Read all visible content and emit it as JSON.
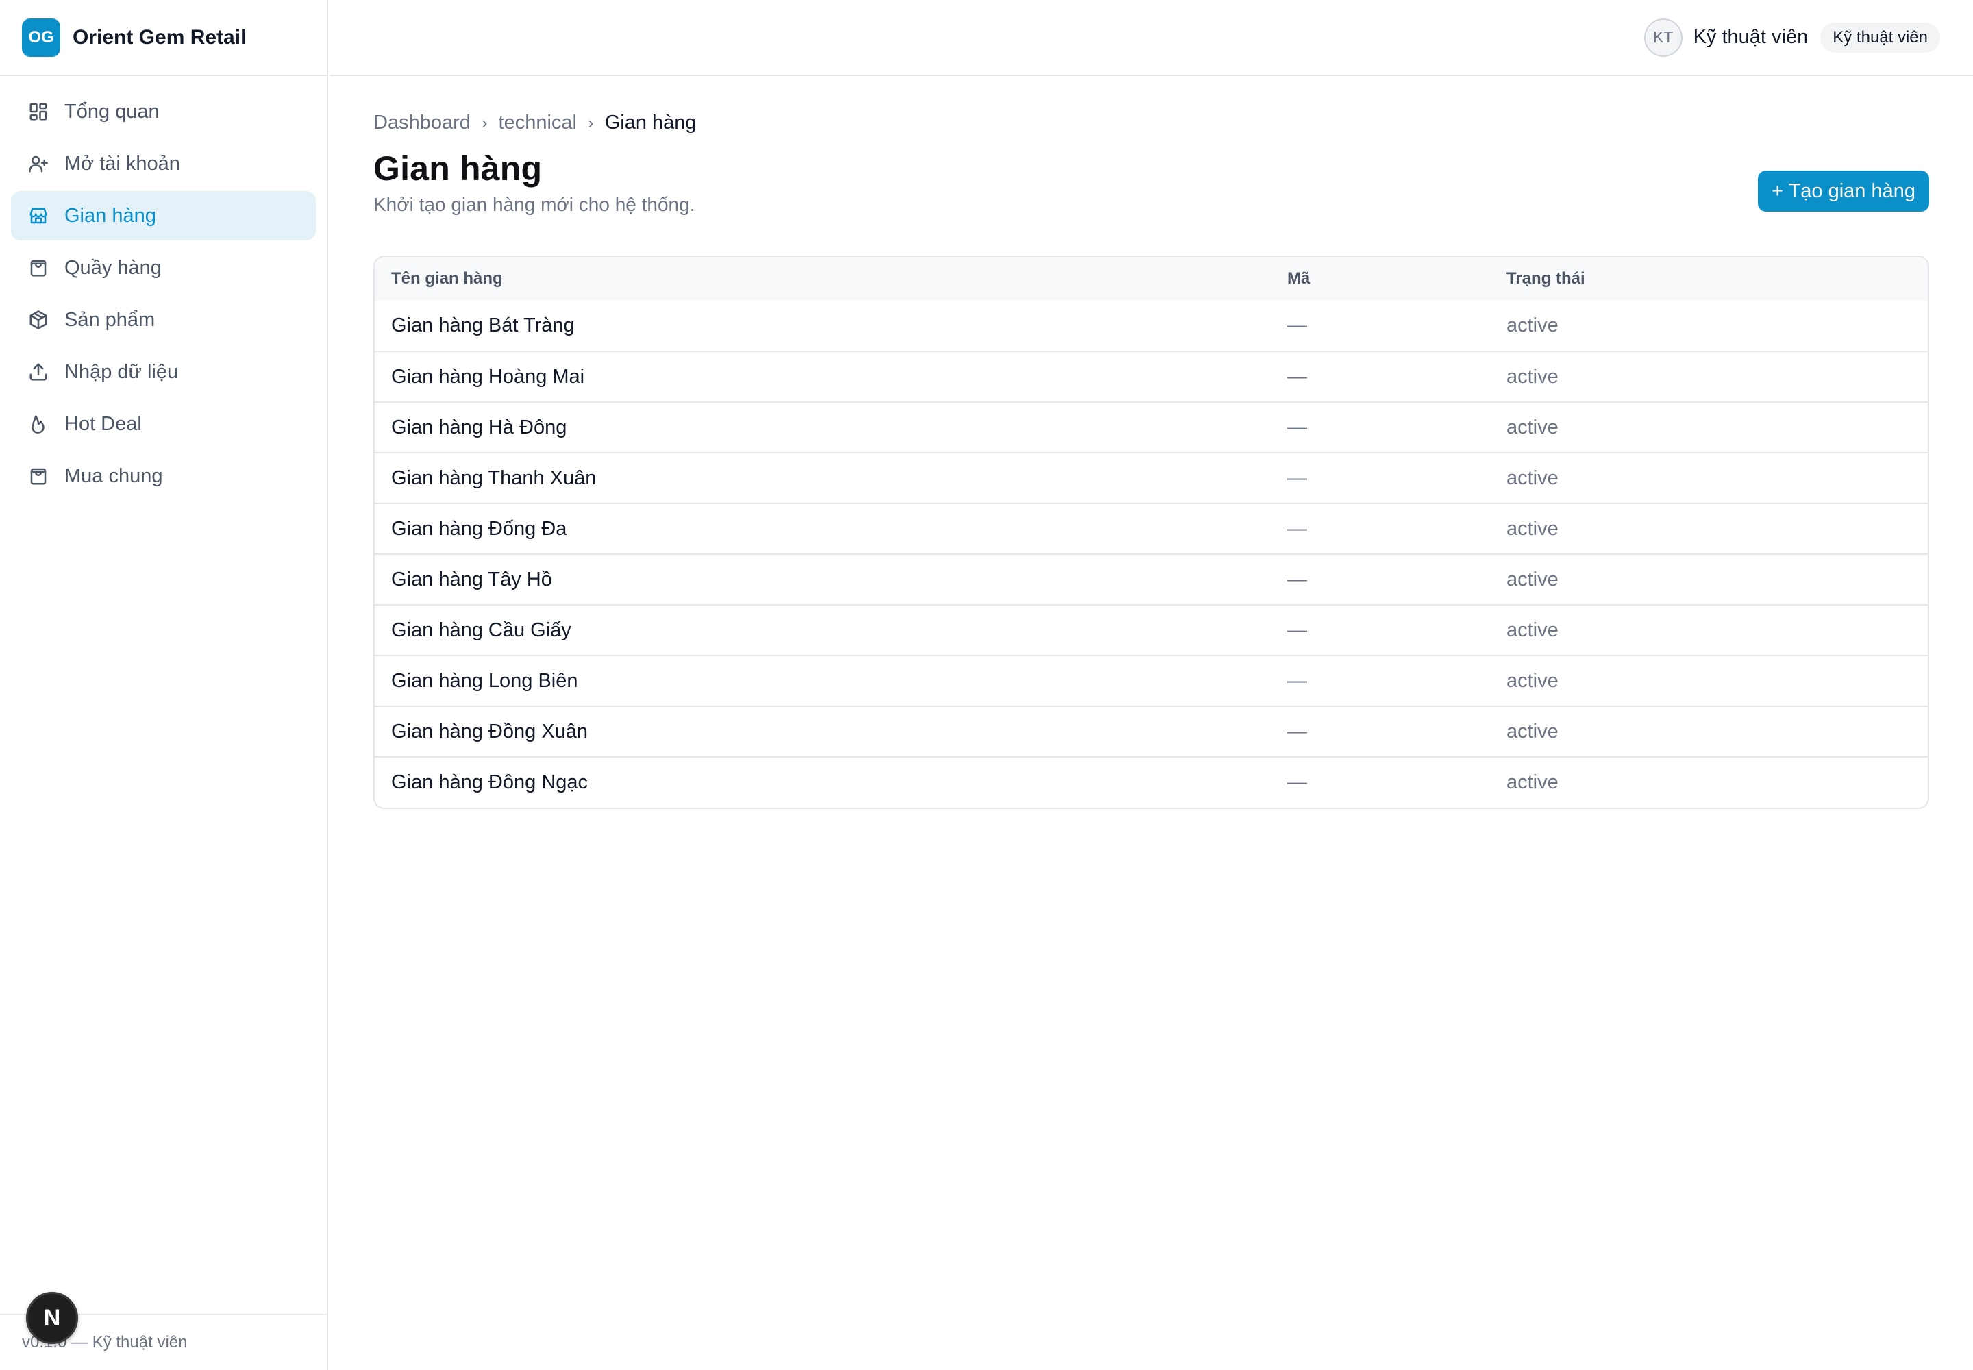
{
  "brand": {
    "logo": "OG",
    "name": "Orient Gem Retail"
  },
  "sidebar": {
    "items": [
      {
        "label": "Tổng quan",
        "icon": "dashboard-icon",
        "active": false
      },
      {
        "label": "Mở tài khoản",
        "icon": "user-plus-icon",
        "active": false
      },
      {
        "label": "Gian hàng",
        "icon": "store-icon",
        "active": true
      },
      {
        "label": "Quầy hàng",
        "icon": "shopping-bag-icon",
        "active": false
      },
      {
        "label": "Sản phẩm",
        "icon": "box-icon",
        "active": false
      },
      {
        "label": "Nhập dữ liệu",
        "icon": "upload-icon",
        "active": false
      },
      {
        "label": "Hot Deal",
        "icon": "flame-icon",
        "active": false
      },
      {
        "label": "Mua chung",
        "icon": "shopping-bag-icon",
        "active": false
      }
    ],
    "footer": "v0.1.0 — Kỹ thuật viên",
    "dev_badge": "N"
  },
  "header": {
    "avatar": "KT",
    "user_name": "Kỹ thuật viên",
    "role": "Kỹ thuật viên"
  },
  "breadcrumb": [
    "Dashboard",
    "technical",
    "Gian hàng"
  ],
  "page": {
    "title": "Gian hàng",
    "subtitle": "Khởi tạo gian hàng mới cho hệ thống.",
    "create_button": "+ Tạo gian hàng"
  },
  "table": {
    "columns": [
      "Tên gian hàng",
      "Mã",
      "Trạng thái"
    ],
    "rows": [
      {
        "name": "Gian hàng Bát Tràng",
        "code": "—",
        "status": "active"
      },
      {
        "name": "Gian hàng Hoàng Mai",
        "code": "—",
        "status": "active"
      },
      {
        "name": "Gian hàng Hà Đông",
        "code": "—",
        "status": "active"
      },
      {
        "name": "Gian hàng Thanh Xuân",
        "code": "—",
        "status": "active"
      },
      {
        "name": "Gian hàng Đống Đa",
        "code": "—",
        "status": "active"
      },
      {
        "name": "Gian hàng Tây Hồ",
        "code": "—",
        "status": "active"
      },
      {
        "name": "Gian hàng Cầu Giấy",
        "code": "—",
        "status": "active"
      },
      {
        "name": "Gian hàng Long Biên",
        "code": "—",
        "status": "active"
      },
      {
        "name": "Gian hàng Đồng Xuân",
        "code": "—",
        "status": "active"
      },
      {
        "name": "Gian hàng Đông Ngạc",
        "code": "—",
        "status": "active"
      }
    ]
  },
  "colors": {
    "accent": "#0b8fc9",
    "active_bg": "#e4f1f8",
    "border": "#e5e7eb",
    "muted_text": "#6b7280"
  }
}
